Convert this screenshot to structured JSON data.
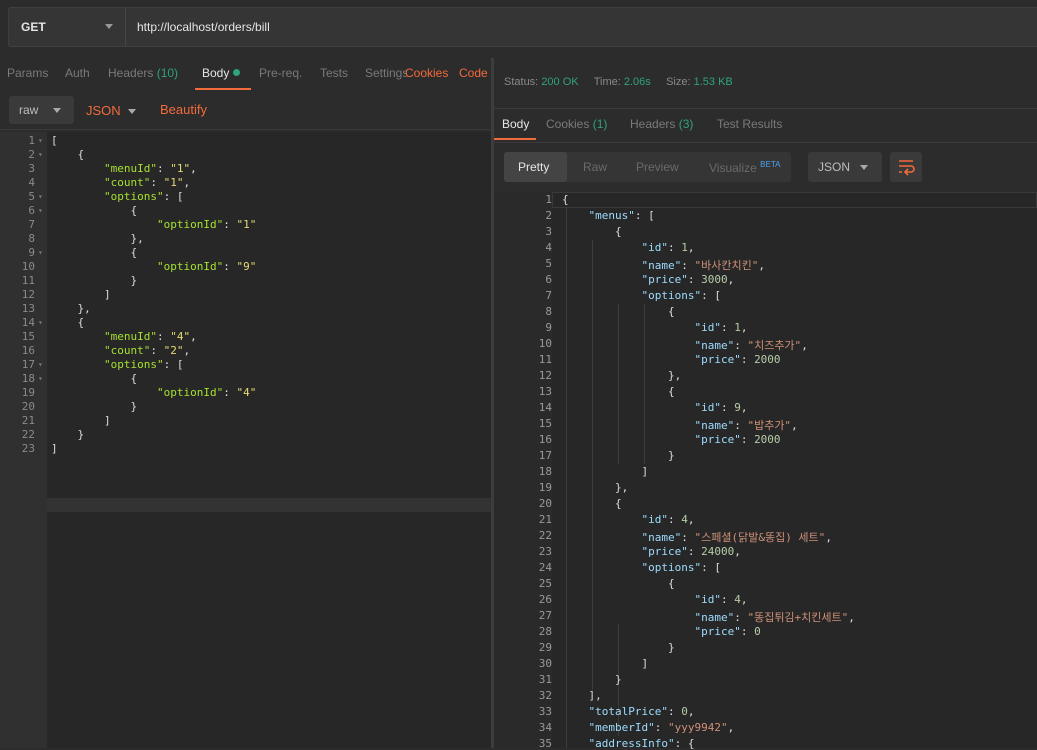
{
  "request": {
    "method": "GET",
    "url": "http://localhost/orders/bill",
    "tabs": {
      "params": "Params",
      "auth": "Auth",
      "headers": "Headers",
      "headers_count": "(10)",
      "body": "Body",
      "prereq": "Pre-req.",
      "tests": "Tests",
      "settings": "Settings"
    },
    "cookies_link": "Cookies",
    "code_link": "Code",
    "body_mode": "raw",
    "body_format": "JSON",
    "beautify": "Beautify",
    "editor_lines": [
      {
        "n": "1",
        "t": "["
      },
      {
        "n": "2",
        "t": "    {"
      },
      {
        "n": "3",
        "t": "        \"menuId\": \"1\","
      },
      {
        "n": "4",
        "t": "        \"count\": \"1\","
      },
      {
        "n": "5",
        "t": "        \"options\": ["
      },
      {
        "n": "6",
        "t": "            {"
      },
      {
        "n": "7",
        "t": "                \"optionId\": \"1\""
      },
      {
        "n": "8",
        "t": "            },"
      },
      {
        "n": "9",
        "t": "            {"
      },
      {
        "n": "10",
        "t": "                \"optionId\": \"9\""
      },
      {
        "n": "11",
        "t": "            }"
      },
      {
        "n": "12",
        "t": "        ]"
      },
      {
        "n": "13",
        "t": "    },"
      },
      {
        "n": "14",
        "t": "    {"
      },
      {
        "n": "15",
        "t": "        \"menuId\": \"4\","
      },
      {
        "n": "16",
        "t": "        \"count\": \"2\","
      },
      {
        "n": "17",
        "t": "        \"options\": ["
      },
      {
        "n": "18",
        "t": "            {"
      },
      {
        "n": "19",
        "t": "                \"optionId\": \"4\""
      },
      {
        "n": "20",
        "t": "            }"
      },
      {
        "n": "21",
        "t": "        ]"
      },
      {
        "n": "22",
        "t": "    }"
      },
      {
        "n": "23",
        "t": "]"
      }
    ]
  },
  "response": {
    "status_label": "Status:",
    "status_value": "200 OK",
    "time_label": "Time:",
    "time_value": "2.06s",
    "size_label": "Size:",
    "size_value": "1.53 KB",
    "tabs": {
      "body": "Body",
      "cookies": "Cookies",
      "cookies_count": "(1)",
      "headers": "Headers",
      "headers_count": "(3)",
      "test_results": "Test Results"
    },
    "views": {
      "pretty": "Pretty",
      "raw": "Raw",
      "preview": "Preview",
      "visualize": "Visualize",
      "beta": "BETA"
    },
    "format": "JSON",
    "editor_lines": [
      {
        "n": "1",
        "t": "{"
      },
      {
        "n": "2",
        "t": "    \"menus\": ["
      },
      {
        "n": "3",
        "t": "        {"
      },
      {
        "n": "4",
        "t": "            \"id\": 1,"
      },
      {
        "n": "5",
        "t": "            \"name\": \"바사칸치킨\","
      },
      {
        "n": "6",
        "t": "            \"price\": 3000,"
      },
      {
        "n": "7",
        "t": "            \"options\": ["
      },
      {
        "n": "8",
        "t": "                {"
      },
      {
        "n": "9",
        "t": "                    \"id\": 1,"
      },
      {
        "n": "10",
        "t": "                    \"name\": \"치즈추가\","
      },
      {
        "n": "11",
        "t": "                    \"price\": 2000"
      },
      {
        "n": "12",
        "t": "                },"
      },
      {
        "n": "13",
        "t": "                {"
      },
      {
        "n": "14",
        "t": "                    \"id\": 9,"
      },
      {
        "n": "15",
        "t": "                    \"name\": \"밥추가\","
      },
      {
        "n": "16",
        "t": "                    \"price\": 2000"
      },
      {
        "n": "17",
        "t": "                }"
      },
      {
        "n": "18",
        "t": "            ]"
      },
      {
        "n": "19",
        "t": "        },"
      },
      {
        "n": "20",
        "t": "        {"
      },
      {
        "n": "21",
        "t": "            \"id\": 4,"
      },
      {
        "n": "22",
        "t": "            \"name\": \"스페셜(닭발&똥집) 세트\","
      },
      {
        "n": "23",
        "t": "            \"price\": 24000,"
      },
      {
        "n": "24",
        "t": "            \"options\": ["
      },
      {
        "n": "25",
        "t": "                {"
      },
      {
        "n": "26",
        "t": "                    \"id\": 4,"
      },
      {
        "n": "27",
        "t": "                    \"name\": \"똥집튀김+치킨세트\","
      },
      {
        "n": "28",
        "t": "                    \"price\": 0"
      },
      {
        "n": "29",
        "t": "                }"
      },
      {
        "n": "30",
        "t": "            ]"
      },
      {
        "n": "31",
        "t": "        }"
      },
      {
        "n": "32",
        "t": "    ],"
      },
      {
        "n": "33",
        "t": "    \"totalPrice\": 0,"
      },
      {
        "n": "34",
        "t": "    \"memberId\": \"yyy9942\","
      },
      {
        "n": "35",
        "t": "    \"addressInfo\": {"
      }
    ]
  },
  "colors": {
    "accent": "#f26b3a",
    "success": "#2fa37a"
  }
}
